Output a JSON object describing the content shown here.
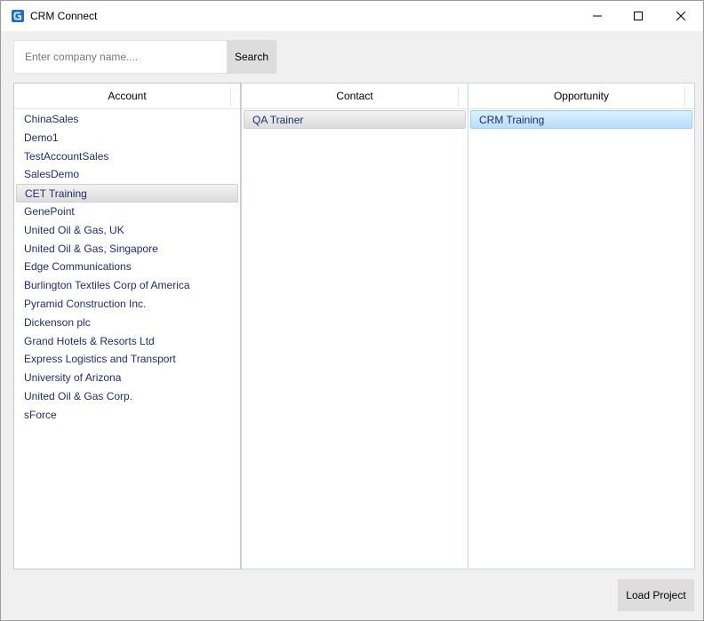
{
  "window": {
    "title": "CRM Connect",
    "icon": "app-logo-icon",
    "controls": [
      "minimize-icon",
      "maximize-icon",
      "close-icon"
    ]
  },
  "search": {
    "placeholder": "Enter company name....",
    "value": "",
    "button_label": "Search"
  },
  "panels": {
    "account": {
      "header": "Account",
      "items": [
        "ChinaSales",
        "Demo1",
        "TestAccountSales",
        "SalesDemo",
        "CET Training",
        "GenePoint",
        "United Oil & Gas, UK",
        "United Oil & Gas, Singapore",
        "Edge Communications",
        "Burlington Textiles Corp of America",
        "Pyramid Construction Inc.",
        "Dickenson plc",
        "Grand Hotels & Resorts Ltd",
        "Express Logistics and Transport",
        "University of Arizona",
        "United Oil & Gas Corp.",
        "sForce"
      ],
      "selected": "CET Training"
    },
    "contact": {
      "header": "Contact",
      "items": [
        "QA Trainer"
      ],
      "selected": "QA Trainer"
    },
    "opportunity": {
      "header": "Opportunity",
      "items": [
        "CRM Training"
      ],
      "selected": "CRM Training"
    }
  },
  "footer": {
    "load_label": "Load Project"
  },
  "colors": {
    "accent": "#1e6fc9",
    "list_text": "#1f2d6b",
    "selection_blue": "#b8defb",
    "selection_gray": "#dcdcdc"
  }
}
